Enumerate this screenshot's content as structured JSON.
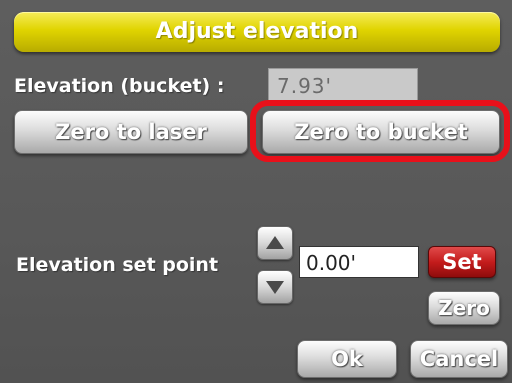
{
  "dialog": {
    "title": "Adjust elevation"
  },
  "elevation_bucket": {
    "label": "Elevation (bucket) :",
    "value": "7.93'"
  },
  "buttons": {
    "zero_to_laser": "Zero to laser",
    "zero_to_bucket": "Zero to bucket",
    "set": "Set",
    "zero": "Zero",
    "ok": "Ok",
    "cancel": "Cancel"
  },
  "setpoint": {
    "label": "Elevation set point",
    "value": "0.00'"
  },
  "icons": {
    "up": "arrow-up-icon",
    "down": "arrow-down-icon"
  },
  "colors": {
    "title_bar": "#e0d400",
    "panel": "#585858",
    "set_button": "#c41c1c",
    "highlight": "#e8101a"
  }
}
